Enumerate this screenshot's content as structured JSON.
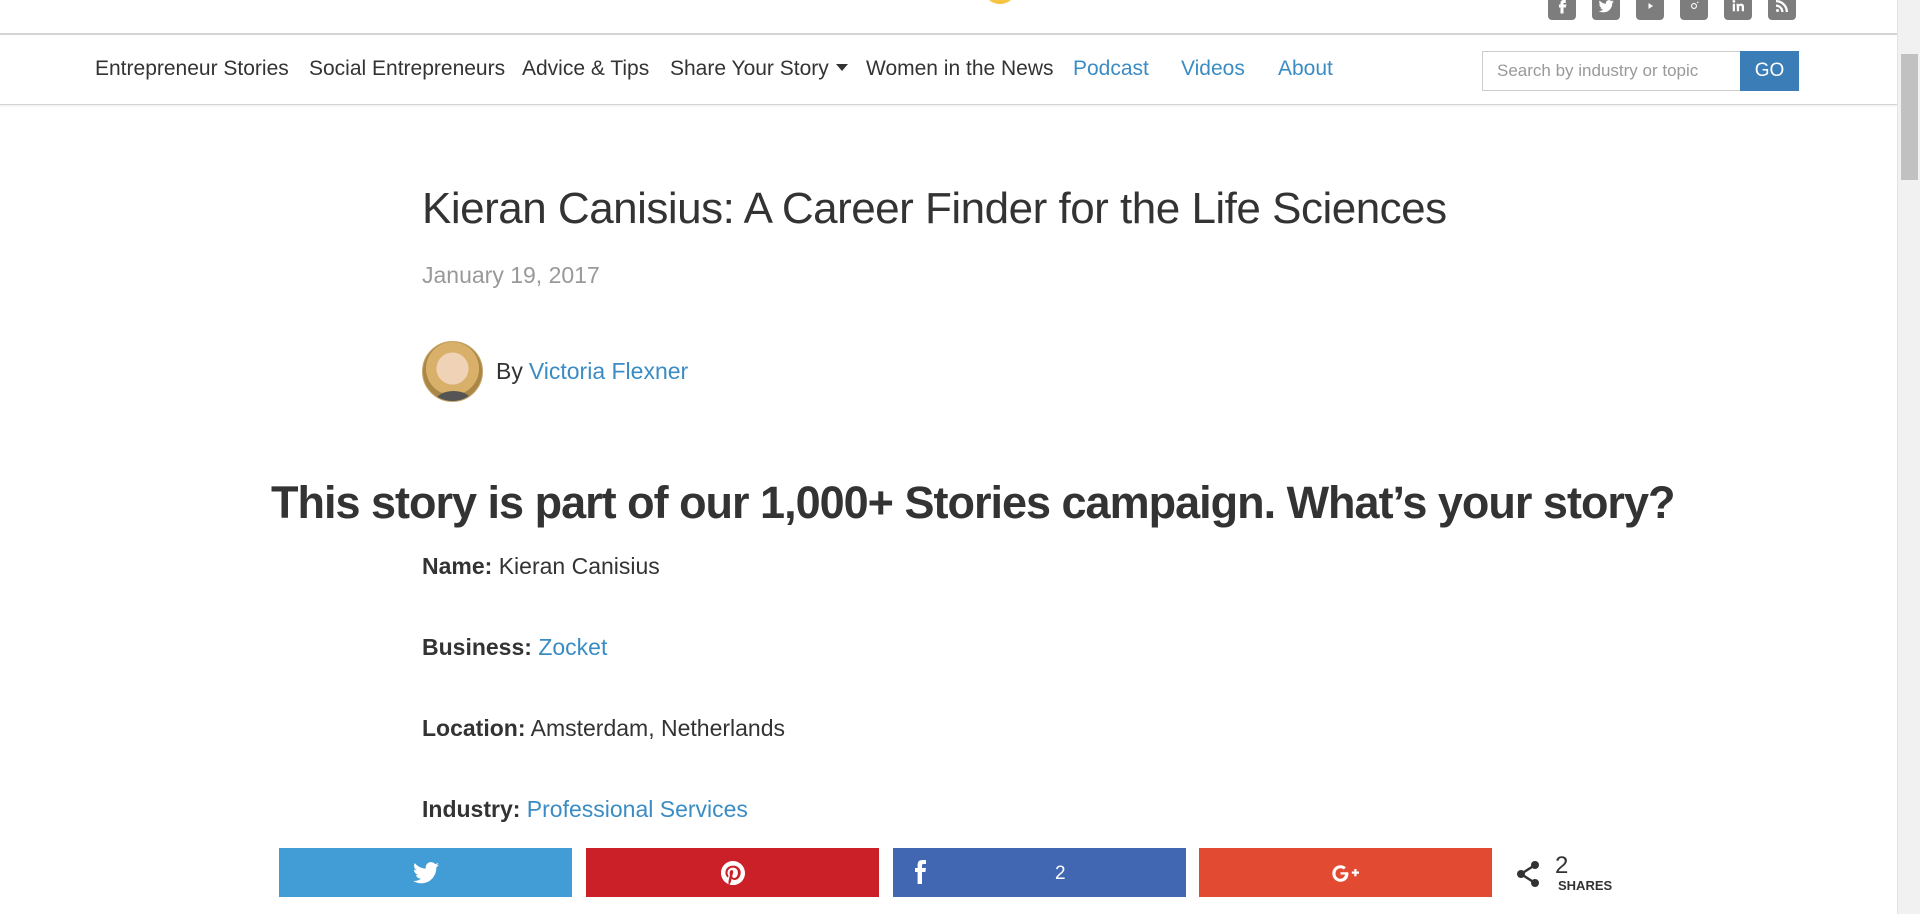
{
  "header": {
    "social_icons": [
      "facebook-icon",
      "twitter-icon",
      "youtube-icon",
      "instagram-icon",
      "linkedin-icon",
      "rss-icon"
    ]
  },
  "nav": {
    "items": [
      {
        "label": "Entrepreneur Stories"
      },
      {
        "label": "Social Entrepreneurs"
      },
      {
        "label": "Advice & Tips"
      },
      {
        "label": "Share Your Story"
      },
      {
        "label": "Women in the News"
      },
      {
        "label": "Podcast"
      },
      {
        "label": "Videos"
      },
      {
        "label": "About"
      }
    ],
    "search_placeholder": "Search by industry or topic",
    "go_label": "GO"
  },
  "article": {
    "title": "Kieran Canisius: A Career Finder for the Life Sciences",
    "date": "January 19, 2017",
    "by": "By",
    "author": "Victoria Flexner",
    "campaign": "This story is part of our 1,000+ Stories campaign. What’s your story?",
    "fields": [
      {
        "label": "Name:",
        "value": "Kieran Canisius"
      },
      {
        "label": "Business:",
        "value": "Zocket"
      },
      {
        "label": "Location:",
        "value": "Amsterdam, Netherlands"
      },
      {
        "label": "Industry:",
        "value": "Professional Services"
      }
    ]
  },
  "share": {
    "facebook_count": "2",
    "total": "2",
    "total_label": "SHARES"
  },
  "colors": {
    "link": "#3b8cc4",
    "go_button": "#3b7db7",
    "twitter": "#429cd6",
    "pinterest": "#cb2027",
    "facebook": "#4267b2",
    "google_plus": "#e24b32"
  }
}
